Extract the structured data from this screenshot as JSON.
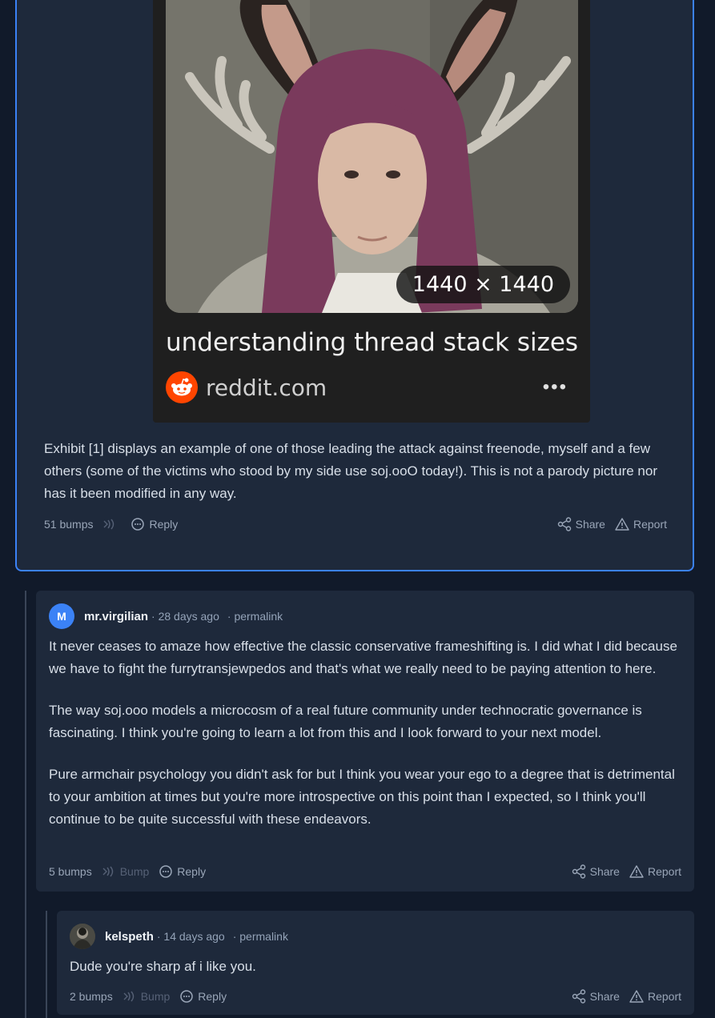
{
  "embed": {
    "dimensions": "1440 × 1440",
    "title": "understanding thread stack sizes ...",
    "site": "reddit.com",
    "more": "•••"
  },
  "post": {
    "body": "Exhibit [1] displays an example of one of those leading the attack against freenode, myself and a few others (some of the victims who stood by my side use soj.ooO today!).  This is not a parody picture nor has it been modified in any way.",
    "bumps": "51 bumps",
    "reply": "Reply",
    "share": "Share",
    "report": "Report"
  },
  "comments": [
    {
      "avatar_letter": "M",
      "username": "mr.virgilian",
      "age": "· 28 days ago",
      "permalink": "· permalink",
      "paragraphs": [
        "It never ceases to amaze how effective the classic conservative frameshifting is. I did what I did because we have to fight the furrytransjewpedos and that's what we really need to be paying attention to here.",
        "The way soj.ooo models a microcosm of a real future community under technocratic governance is fascinating. I think you're going to learn a lot from this and I look forward to your next model.",
        "Pure armchair psychology you didn't ask for but I think you wear your ego to a degree that is detrimental to your ambition at times but you're more introspective on this point than I expected, so I think you'll continue to be quite successful with these endeavors."
      ],
      "bumps": "5 bumps",
      "bump": "Bump",
      "reply": "Reply",
      "share": "Share",
      "report": "Report"
    },
    {
      "username": "kelspeth",
      "age": "· 14 days ago",
      "permalink": "· permalink",
      "paragraphs": [
        "Dude you're sharp af i like you."
      ],
      "bumps": "2 bumps",
      "bump": "Bump",
      "reply": "Reply",
      "share": "Share",
      "report": "Report"
    }
  ],
  "colors": {
    "background": "#111a2a",
    "card": "#1e293b",
    "accent": "#3b82f6",
    "reddit": "#ff4500"
  }
}
